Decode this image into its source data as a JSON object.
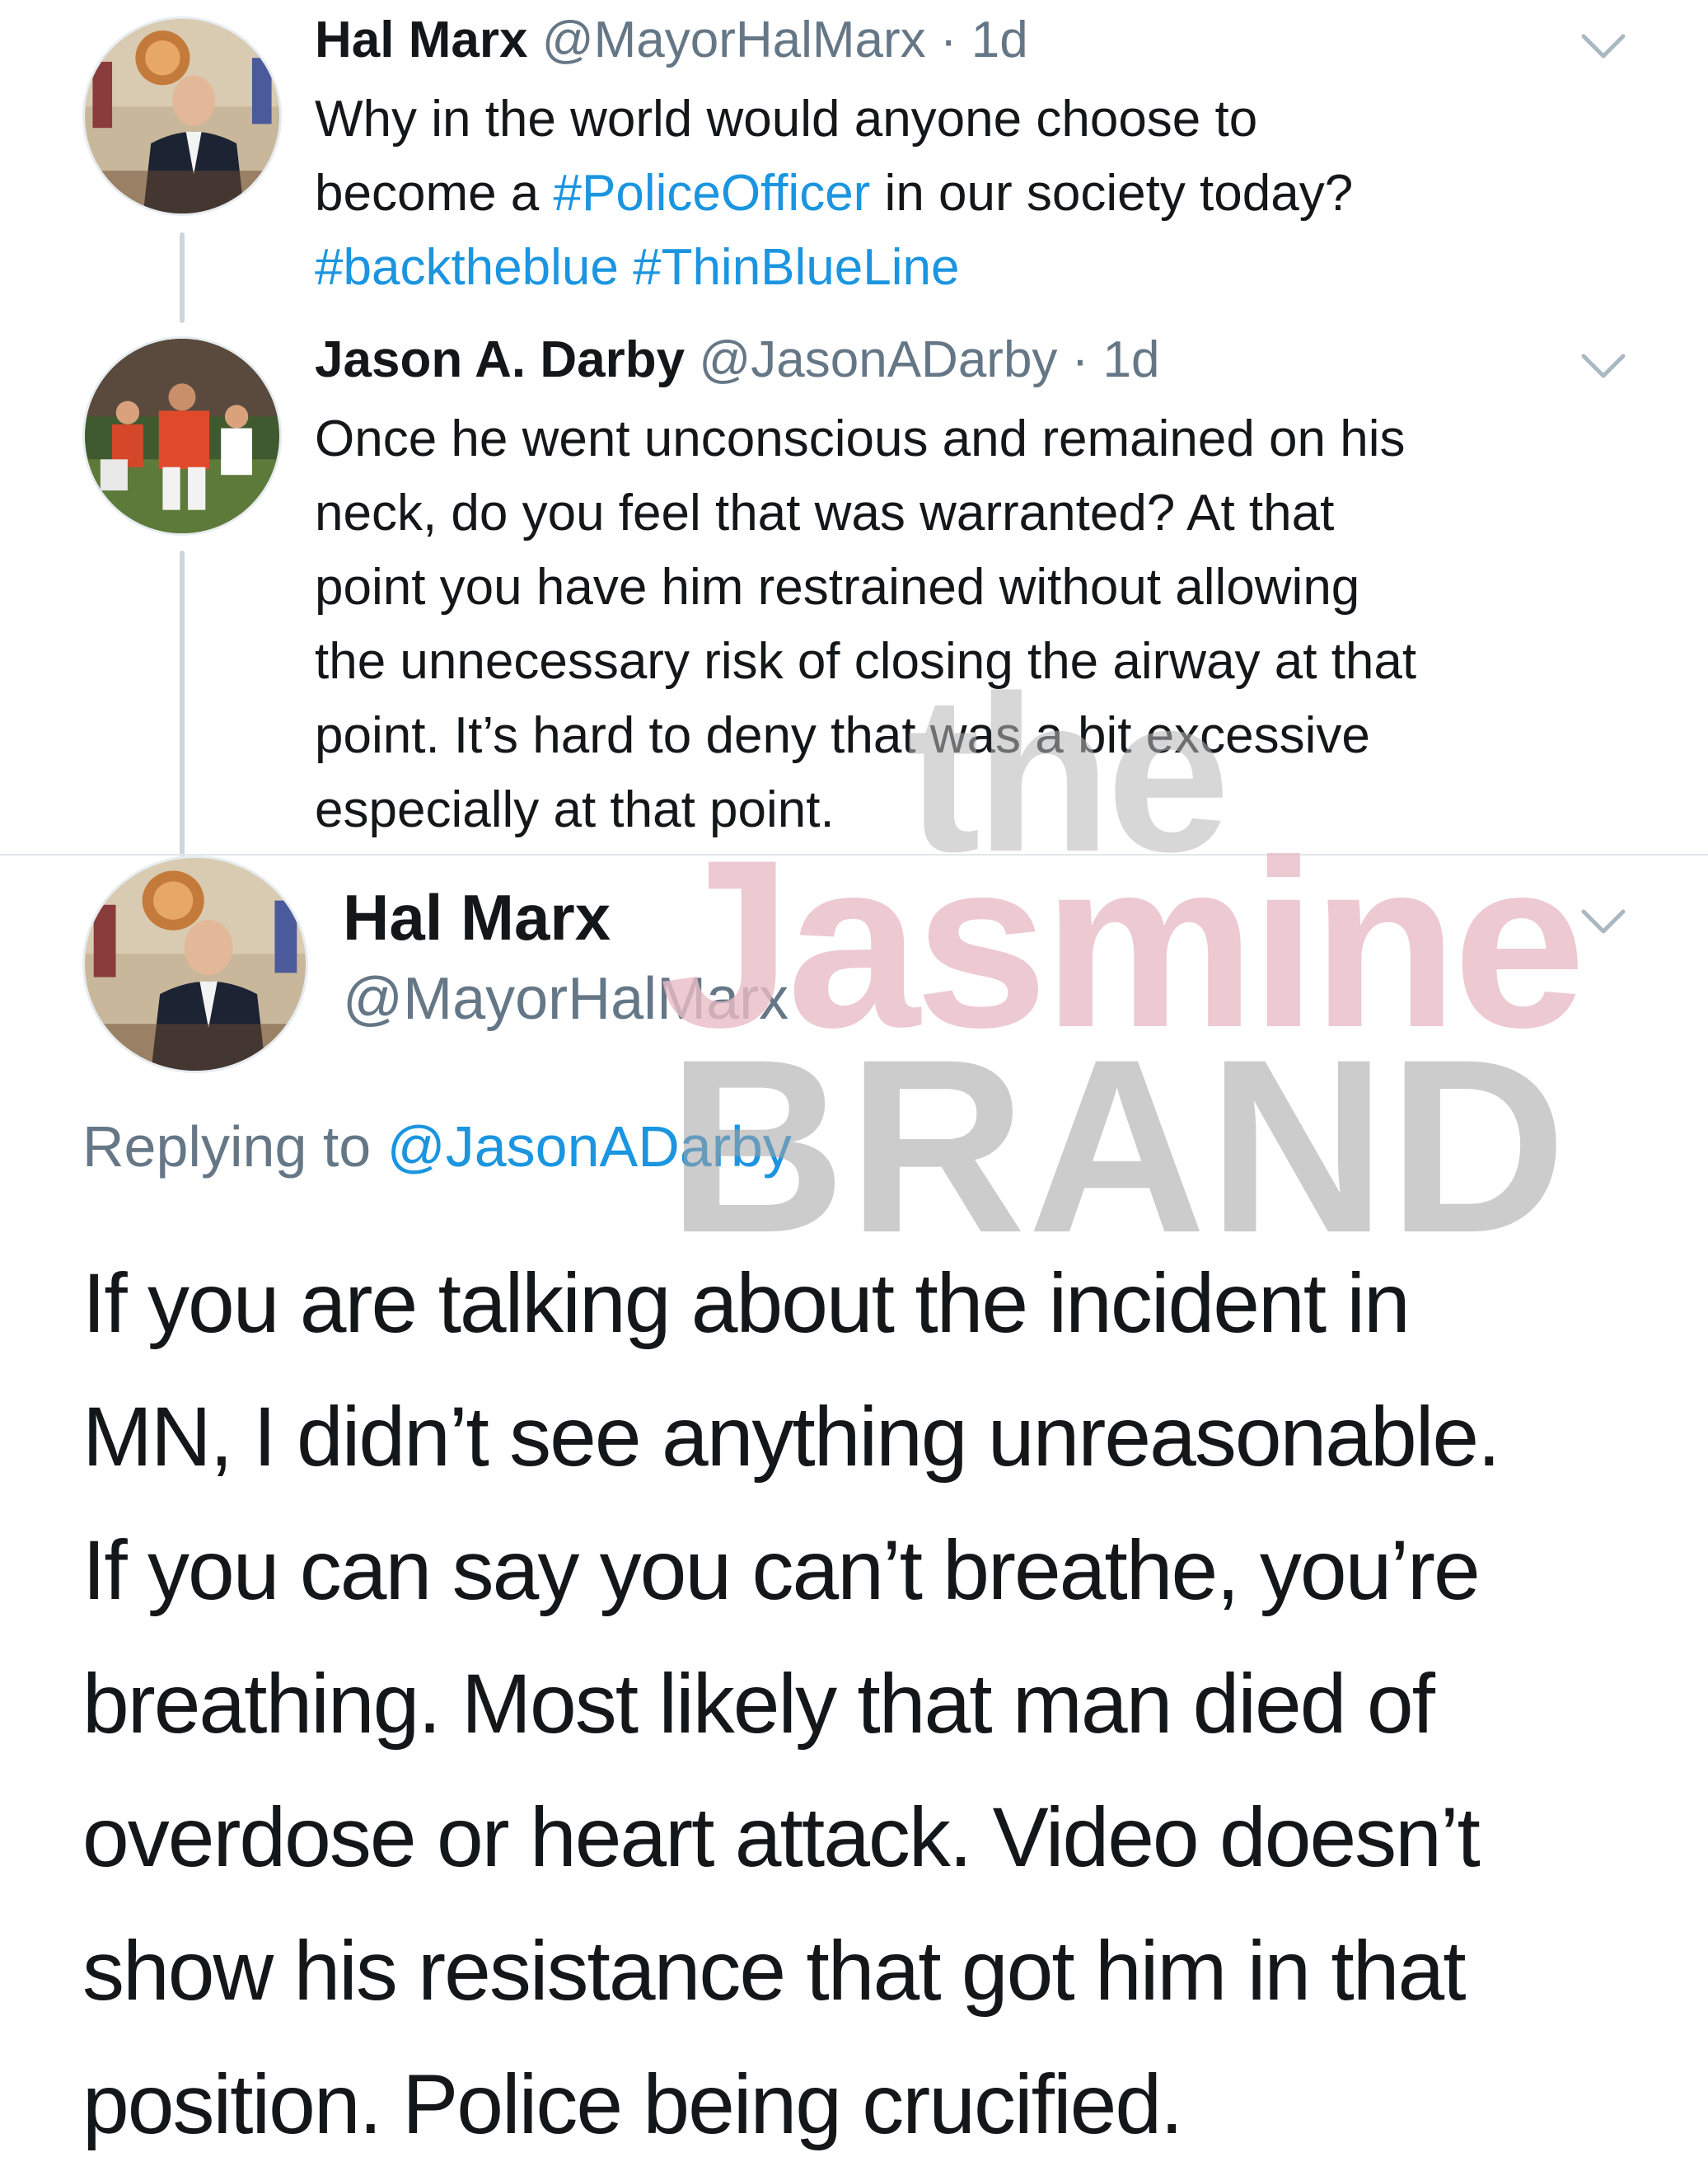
{
  "tweet1": {
    "name": "Hal Marx",
    "handle": "@MayorHalMarx",
    "time": "· 1d",
    "line1": "Why in the world would anyone choose to",
    "line2_pre": "become a ",
    "hashtag_police": "#PoliceOfficer",
    "line2_post": " in our society today?",
    "hashtag_back": "#backtheblue",
    "hashtag_thin": "#ThinBlueLine"
  },
  "tweet2": {
    "name": "Jason A. Darby",
    "handle": "@JasonADarby",
    "time": "· 1d",
    "lines": [
      "Once he went unconscious and remained on his",
      "neck, do you feel that was warranted? At that",
      "point you have him restrained without allowing",
      "the unnecessary risk of closing the airway at that",
      "point. It’s hard to deny that was a bit excessive",
      "especially at that point."
    ]
  },
  "main_tweet": {
    "name": "Hal Marx",
    "handle": "@MayorHalMarx",
    "replying_label": "Replying to",
    "replying_to": "@JasonADarby",
    "lines": [
      "If you are talking about the incident in",
      "MN, I didn’t see anything unreasonable.",
      "If you can say you can’t breathe, you’re",
      "breathing. Most likely that man died of",
      "overdose or heart attack. Video doesn’t",
      "show his resistance that got him in that",
      "position. Police being crucified."
    ]
  },
  "watermark": {
    "line1": "the",
    "line2": "Jasmine",
    "line3": "BRAND"
  },
  "icons": {
    "chevron": "chevron-down-icon",
    "avatar_hal": "avatar-hal-marx",
    "avatar_jason": "avatar-jason-darby"
  },
  "colors": {
    "link": "#1b95e0",
    "meta": "#657786",
    "text": "#14171a",
    "watermark_pink": "#e9bcc6",
    "watermark_gray": "#a3a3a3"
  }
}
